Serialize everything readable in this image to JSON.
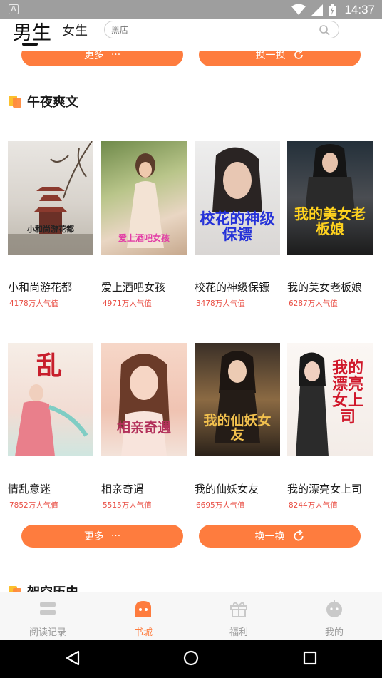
{
  "status_bar": {
    "app_badge": "A",
    "time": "14:37"
  },
  "header": {
    "tab_male": "男生",
    "tab_female": "女生",
    "search_placeholder": "黑店"
  },
  "top_buttons": {
    "more_label": "更多",
    "swap_label": "换一换"
  },
  "section_midnight": {
    "title": "午夜爽文",
    "books": [
      {
        "title": "小和尚游花都",
        "popularity": "4178万人气值",
        "cover_text": "小和尚游花都"
      },
      {
        "title": "爱上酒吧女孩",
        "popularity": "4971万人气值",
        "cover_text": "爱上酒吧女孩"
      },
      {
        "title": "校花的神级保镖",
        "popularity": "3478万人气值",
        "cover_text": "校花的神级保镖"
      },
      {
        "title": "我的美女老板娘",
        "popularity": "6287万人气值",
        "cover_text": "我的美女老板娘"
      },
      {
        "title": "情乱意迷",
        "popularity": "7852万人气值",
        "cover_text": "乱"
      },
      {
        "title": "相亲奇遇",
        "popularity": "5515万人气值",
        "cover_text": "相亲奇遇"
      },
      {
        "title": "我的仙妖女友",
        "popularity": "6695万人气值",
        "cover_text": "我的仙妖女友"
      },
      {
        "title": "我的漂亮女上司",
        "popularity": "8244万人气值",
        "cover_text": "我的漂亮女上司"
      }
    ],
    "more_label": "更多",
    "more_dots": "···",
    "swap_label": "换一换"
  },
  "section_history": {
    "title": "架空历史"
  },
  "bottom_nav": {
    "items": [
      {
        "label": "阅读记录",
        "icon": "books-stack-icon",
        "active": false
      },
      {
        "label": "书城",
        "icon": "bookstore-icon",
        "active": true
      },
      {
        "label": "福利",
        "icon": "gift-icon",
        "active": false
      },
      {
        "label": "我的",
        "icon": "profile-face-icon",
        "active": false
      }
    ]
  },
  "colors": {
    "accent": "#fe7c3e",
    "popularity_text": "#e94f45",
    "status_bar": "#9e9e9e"
  }
}
